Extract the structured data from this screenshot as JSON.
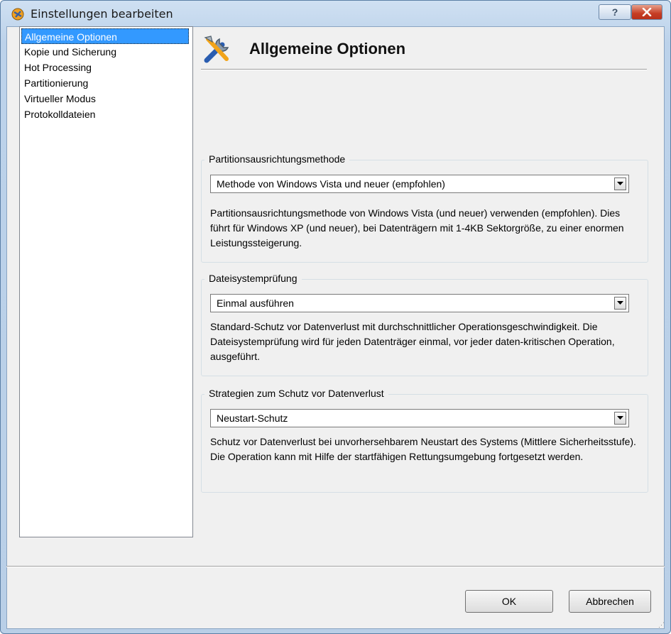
{
  "window": {
    "title": "Einstellungen bearbeiten",
    "help_label": "?"
  },
  "nav": {
    "items": [
      {
        "label": "Allgemeine Optionen",
        "selected": true
      },
      {
        "label": "Kopie und Sicherung"
      },
      {
        "label": "Hot Processing"
      },
      {
        "label": "Partitionierung"
      },
      {
        "label": "Virtueller Modus"
      },
      {
        "label": "Protokolldateien"
      }
    ]
  },
  "header": {
    "title": "Allgemeine Optionen",
    "icon": "tools-icon"
  },
  "groups": [
    {
      "title": "Partitionsausrichtungsmethode",
      "selected": "Methode von Windows Vista und neuer (empfohlen)",
      "description": "Partitionsausrichtungsmethode von Windows Vista (und neuer) verwenden (empfohlen). Dies führt für Windows XP (und neuer), bei Datenträgern mit 1-4KB Sektorgröße, zu einer enormen Leistungssteigerung."
    },
    {
      "title": "Dateisystemprüfung",
      "selected": "Einmal ausführen",
      "description": "Standard-Schutz vor Datenverlust mit durchschnittlicher Operationsgeschwindigkeit. Die Dateisystemprüfung wird für jeden Datenträger einmal, vor jeder daten-kritischen Operation, ausgeführt."
    },
    {
      "title": "Strategien zum Schutz vor Datenverlust",
      "selected": "Neustart-Schutz",
      "description": "Schutz vor Datenverlust bei unvorhersehbarem Neustart des Systems (Mittlere Sicherheitsstufe). Die Operation kann mit Hilfe der startfähigen Rettungsumgebung fortgesetzt werden."
    }
  ],
  "buttons": {
    "ok": "OK",
    "cancel": "Abbrechen"
  },
  "colors": {
    "selection": "#3399ff",
    "close_button": "#c63d24"
  }
}
